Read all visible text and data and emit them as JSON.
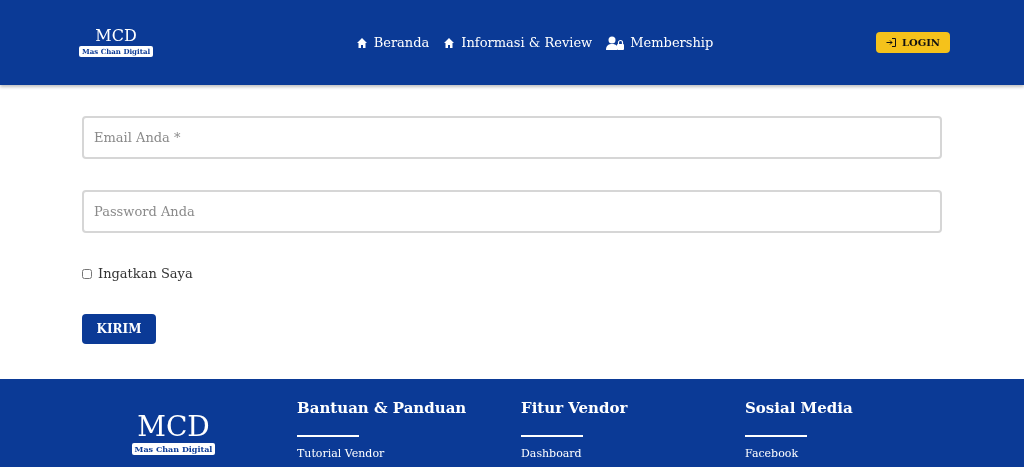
{
  "header": {
    "logo": {
      "title": "MCD",
      "subtitle": "Mas Chan Digital"
    },
    "nav": [
      {
        "label": "Beranda",
        "kind": "home"
      },
      {
        "label": "Informasi & Review",
        "kind": "home"
      },
      {
        "label": "Membership",
        "kind": "member"
      }
    ],
    "login_button": "LOGIN"
  },
  "form": {
    "email": {
      "placeholder": "Email Anda *"
    },
    "password": {
      "placeholder": "Password Anda"
    },
    "remember": {
      "label": "Ingatkan Saya",
      "checked": false
    },
    "submit": "KIRIM"
  },
  "footer": {
    "logo": {
      "title": "MCD",
      "subtitle": "Mas Chan Digital"
    },
    "columns": [
      {
        "heading": "Bantuan & Panduan",
        "links": [
          "Tutorial Vendor"
        ]
      },
      {
        "heading": "Fitur Vendor",
        "links": [
          "Dashboard"
        ]
      },
      {
        "heading": "Sosial Media",
        "links": [
          "Facebook"
        ]
      }
    ]
  }
}
